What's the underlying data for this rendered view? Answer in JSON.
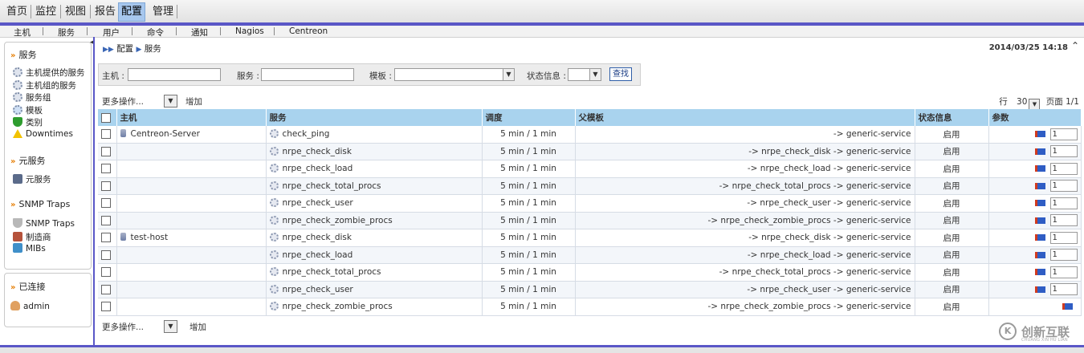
{
  "top_menu": {
    "items": [
      "首页",
      "监控",
      "视图",
      "报告",
      "配置",
      "管理"
    ],
    "active": "配置"
  },
  "sub_menu": [
    "主机",
    "服务",
    "用户",
    "命令",
    "通知",
    "Nagios",
    "Centreon"
  ],
  "sidebar": {
    "services_header": "服务",
    "services_items": [
      {
        "label": "主机提供的服务",
        "icon": "gear-icon"
      },
      {
        "label": "主机组的服务",
        "icon": "gear-icon"
      },
      {
        "label": "服务组",
        "icon": "gears-icon"
      },
      {
        "label": "模板",
        "icon": "template-icon"
      },
      {
        "label": "类别",
        "icon": "shield-icon"
      },
      {
        "label": "Downtimes",
        "icon": "warning-icon"
      }
    ],
    "meta_header": "元服务",
    "meta_items": [
      {
        "label": "元服务",
        "icon": "meta-service-icon"
      }
    ],
    "snmp_header": "SNMP Traps",
    "snmp_items": [
      {
        "label": "SNMP Traps",
        "icon": "trap-icon"
      },
      {
        "label": "制造商",
        "icon": "manufacturer-icon"
      },
      {
        "label": "MIBs",
        "icon": "mib-icon"
      }
    ],
    "connected_header": "已连接",
    "connected_user": "admin"
  },
  "breadcrumb": [
    "配置",
    "服务"
  ],
  "datetime": "2014/03/25 14:18",
  "filter": {
    "host_label": "主机 :",
    "service_label": "服务 :",
    "template_label": "模板 :",
    "status_label": "状态信息 :",
    "search_button": "查找"
  },
  "actions": {
    "more_ops": "更多操作...",
    "add": "增加"
  },
  "pager": {
    "rows_label": "行",
    "rows_value": "30",
    "page_label": "页面 1/1"
  },
  "table": {
    "headers": [
      "主机",
      "服务",
      "调度",
      "父模板",
      "状态信息",
      "参数"
    ],
    "rows": [
      {
        "host": "Centreon-Server",
        "service": "check_ping",
        "schedule": "5 min / 1 min",
        "parent": "-> generic-service",
        "status": "启用",
        "param": "1"
      },
      {
        "host": "",
        "service": "nrpe_check_disk",
        "schedule": "5 min / 1 min",
        "parent": "-> nrpe_check_disk -> generic-service",
        "status": "启用",
        "param": "1"
      },
      {
        "host": "",
        "service": "nrpe_check_load",
        "schedule": "5 min / 1 min",
        "parent": "-> nrpe_check_load -> generic-service",
        "status": "启用",
        "param": "1"
      },
      {
        "host": "",
        "service": "nrpe_check_total_procs",
        "schedule": "5 min / 1 min",
        "parent": "-> nrpe_check_total_procs -> generic-service",
        "status": "启用",
        "param": "1"
      },
      {
        "host": "",
        "service": "nrpe_check_user",
        "schedule": "5 min / 1 min",
        "parent": "-> nrpe_check_user -> generic-service",
        "status": "启用",
        "param": "1"
      },
      {
        "host": "",
        "service": "nrpe_check_zombie_procs",
        "schedule": "5 min / 1 min",
        "parent": "-> nrpe_check_zombie_procs -> generic-service",
        "status": "启用",
        "param": "1"
      },
      {
        "host": "test-host",
        "service": "nrpe_check_disk",
        "schedule": "5 min / 1 min",
        "parent": "-> nrpe_check_disk -> generic-service",
        "status": "启用",
        "param": "1"
      },
      {
        "host": "",
        "service": "nrpe_check_load",
        "schedule": "5 min / 1 min",
        "parent": "-> nrpe_check_load -> generic-service",
        "status": "启用",
        "param": "1"
      },
      {
        "host": "",
        "service": "nrpe_check_total_procs",
        "schedule": "5 min / 1 min",
        "parent": "-> nrpe_check_total_procs -> generic-service",
        "status": "启用",
        "param": "1"
      },
      {
        "host": "",
        "service": "nrpe_check_user",
        "schedule": "5 min / 1 min",
        "parent": "-> nrpe_check_user -> generic-service",
        "status": "启用",
        "param": "1"
      },
      {
        "host": "",
        "service": "nrpe_check_zombie_procs",
        "schedule": "5 min / 1 min",
        "parent": "-> nrpe_check_zombie_procs -> generic-service",
        "status": "启用",
        "param": ""
      }
    ]
  },
  "watermark": {
    "logo": "K",
    "text": "创新互联",
    "sub": "CHUANG XIN HU LIAN"
  }
}
